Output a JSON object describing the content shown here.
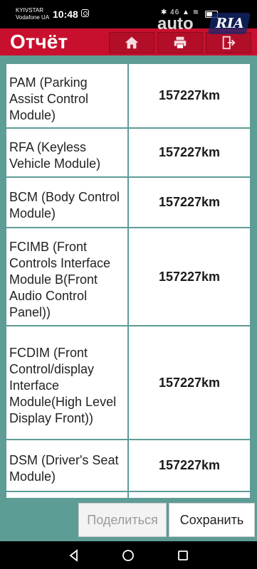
{
  "status_bar": {
    "carrier_line1": "KYIVSTAR",
    "carrier_line2": "Vodafone UA",
    "time": "10:48",
    "icons": "✱ 46 ▲ ≋",
    "instagram_icon": "instagram-icon"
  },
  "header": {
    "title": "Отчёт",
    "buttons": [
      {
        "icon": "home-icon"
      },
      {
        "icon": "printer-icon"
      },
      {
        "icon": "exit-icon"
      }
    ],
    "watermark": {
      "part1": "auto",
      "part2": "RIA"
    },
    "colors": {
      "background": "#c8102e"
    }
  },
  "report_rows": [
    {
      "name": "PAM (Parking Assist Control Module)",
      "value": "157227km"
    },
    {
      "name": "RFA (Keyless Vehicle Module)",
      "value": "157227km"
    },
    {
      "name": "BCM (Body Control Module)",
      "value": "157227km"
    },
    {
      "name": "FCIMB (Front Controls Interface Module B(Front Audio Control Panel))",
      "value": "157227km"
    },
    {
      "name": "FCDIM (Front Control/display Interface Module(High Level Display Front))",
      "value": "157227km"
    },
    {
      "name": "DSM (Driver's Seat Module)",
      "value": "157227km"
    }
  ],
  "actions": {
    "share_label": "Поделиться",
    "save_label": "Сохранить"
  },
  "nav_bar": {
    "icons": [
      "back-icon",
      "home-circle-icon",
      "recents-icon"
    ]
  },
  "colors": {
    "content_background": "#5e9c96",
    "accent": "#c8102e"
  }
}
